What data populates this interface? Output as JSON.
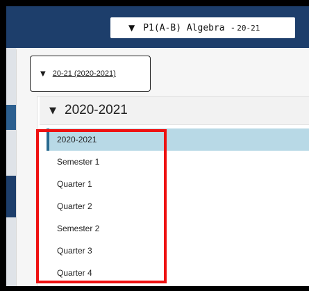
{
  "header": {
    "course_selector": {
      "arrow": "▼",
      "course": "P1(A-B) Algebra -",
      "year": "20-21"
    }
  },
  "school_year_selector": {
    "arrow": "▼",
    "label": "20-21 (2020-2021)"
  },
  "term_tree": {
    "arrow": "▼",
    "title": "2020-2021",
    "items": [
      {
        "label": "2020-2021"
      },
      {
        "label": "Semester 1"
      },
      {
        "label": "Quarter 1"
      },
      {
        "label": "Quarter 2"
      },
      {
        "label": "Semester 2"
      },
      {
        "label": "Quarter 3"
      },
      {
        "label": "Quarter 4"
      }
    ]
  },
  "colors": {
    "header_bg": "#1d3e6b",
    "selected_row_bg": "#b8d9e6",
    "annotation_box": "#ee1111"
  }
}
